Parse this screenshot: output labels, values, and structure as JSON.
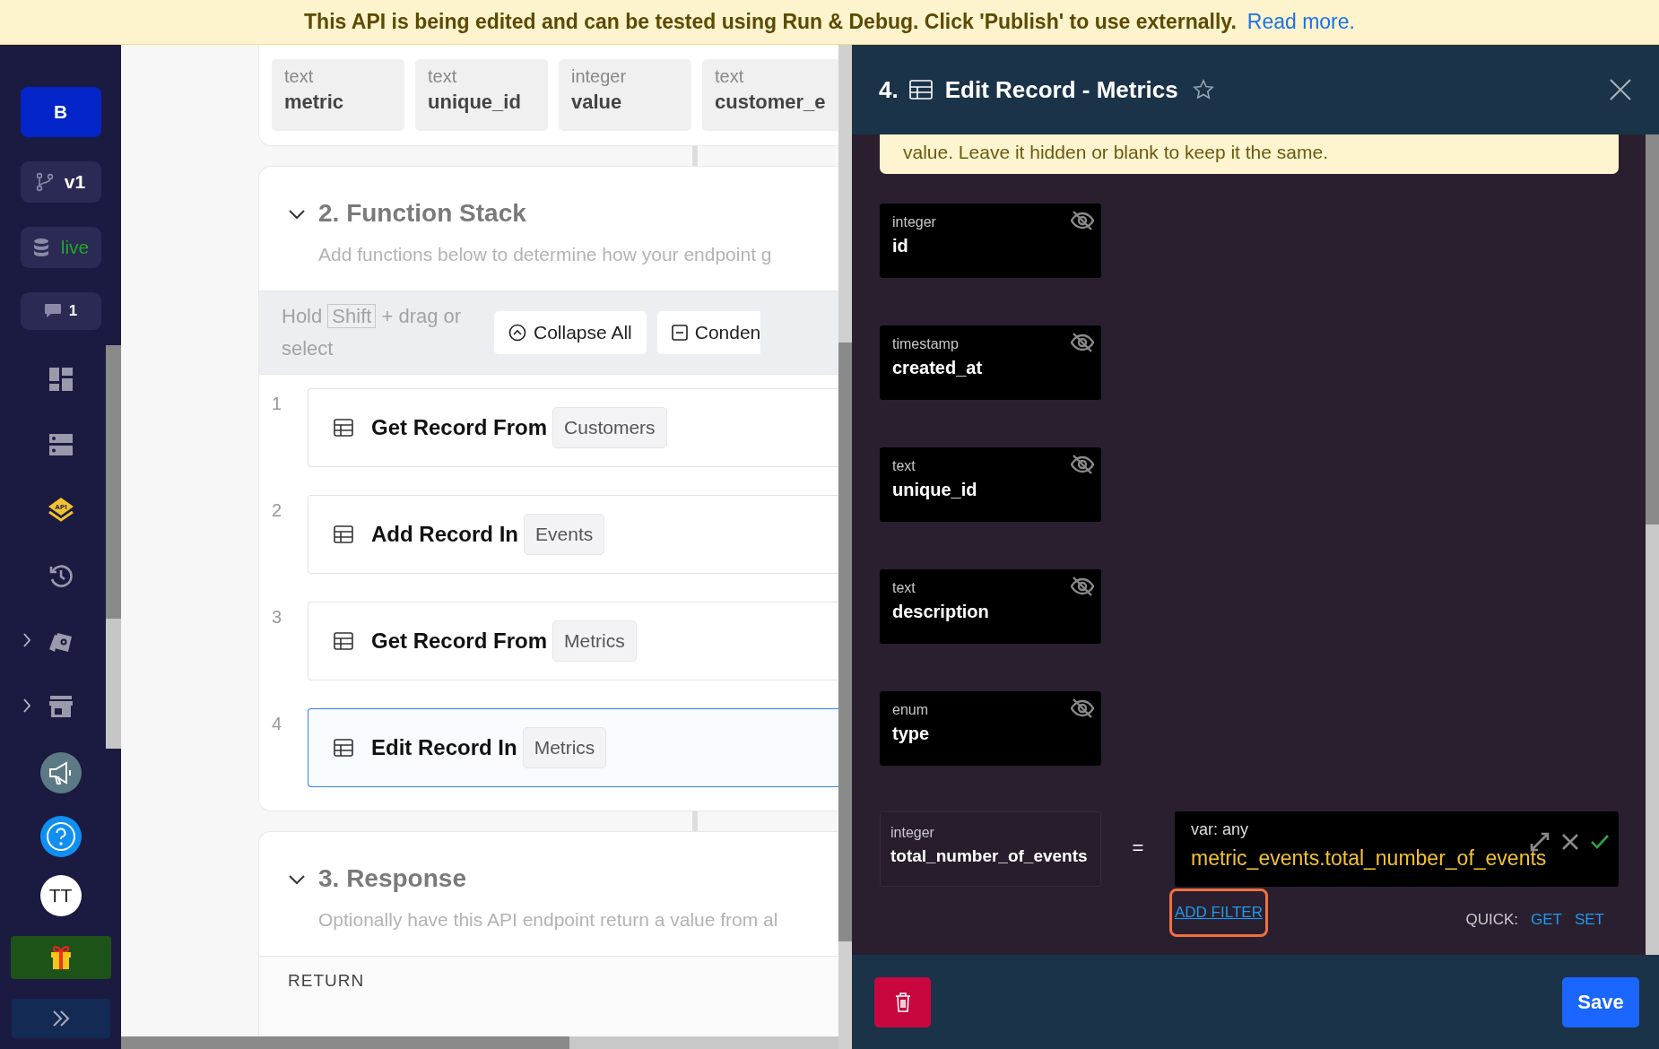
{
  "banner": {
    "text": "This API is being edited and can be tested using Run & Debug. Click 'Publish' to use externally.",
    "link": "Read more."
  },
  "sidebar": {
    "workspace": "B",
    "branch": "v1",
    "datasource": "live",
    "comments": "1",
    "nav": [
      {
        "kind": "dashboard",
        "expandable": false,
        "selected": false
      },
      {
        "kind": "database",
        "expandable": false,
        "selected": false
      },
      {
        "kind": "api",
        "icon_text": "API",
        "expandable": false,
        "selected": true
      },
      {
        "kind": "history",
        "expandable": false,
        "selected": false
      },
      {
        "kind": "addons",
        "expandable": true,
        "selected": false
      },
      {
        "kind": "marketplace",
        "expandable": true,
        "selected": false
      }
    ],
    "avatar": "TT"
  },
  "table_fields": [
    {
      "type": "text",
      "name": "metric"
    },
    {
      "type": "text",
      "name": "unique_id"
    },
    {
      "type": "integer",
      "name": "value"
    },
    {
      "type": "text",
      "name": "customer_e"
    }
  ],
  "function_stack": {
    "title": "2. Function Stack",
    "description": "Add functions below to determine how your endpoint g",
    "hint": {
      "before": "Hold",
      "key": "Shift",
      "after": "+ drag or select"
    },
    "toolbar_buttons": [
      {
        "kind": "collapse",
        "label": "Collapse All"
      },
      {
        "kind": "condense",
        "label": "Conden"
      }
    ],
    "steps": [
      {
        "number": "1",
        "action": "Get Record From",
        "table": "Customers",
        "selected": false
      },
      {
        "number": "2",
        "action": "Add Record In",
        "table": "Events",
        "selected": false
      },
      {
        "number": "3",
        "action": "Get Record From",
        "table": "Metrics",
        "selected": false
      },
      {
        "number": "4",
        "action": "Edit Record In",
        "table": "Metrics",
        "selected": true
      }
    ]
  },
  "response": {
    "title": "3. Response",
    "description": "Optionally have this API endpoint return a value from al",
    "return_label": "RETURN"
  },
  "panel": {
    "number": "4.",
    "title": "Edit Record - Metrics",
    "favorite": false,
    "note": "value. Leave it hidden or blank to keep it the same.",
    "fields": [
      {
        "type": "integer",
        "name": "id",
        "hidden": true
      },
      {
        "type": "timestamp",
        "name": "created_at",
        "hidden": true
      },
      {
        "type": "text",
        "name": "unique_id",
        "hidden": true
      },
      {
        "type": "text",
        "name": "description",
        "hidden": true
      },
      {
        "type": "enum",
        "name": "type",
        "hidden": true
      }
    ],
    "assignment": {
      "type": "integer",
      "name": "total_number_of_events",
      "operator": "=",
      "var_type": "var: any",
      "value": "metric_events.total_number_of_events",
      "valid": true
    },
    "add_filter": "ADD FILTER",
    "quick_label": "QUICK:",
    "quick_actions": [
      "GET",
      "SET"
    ],
    "save": "Save"
  }
}
